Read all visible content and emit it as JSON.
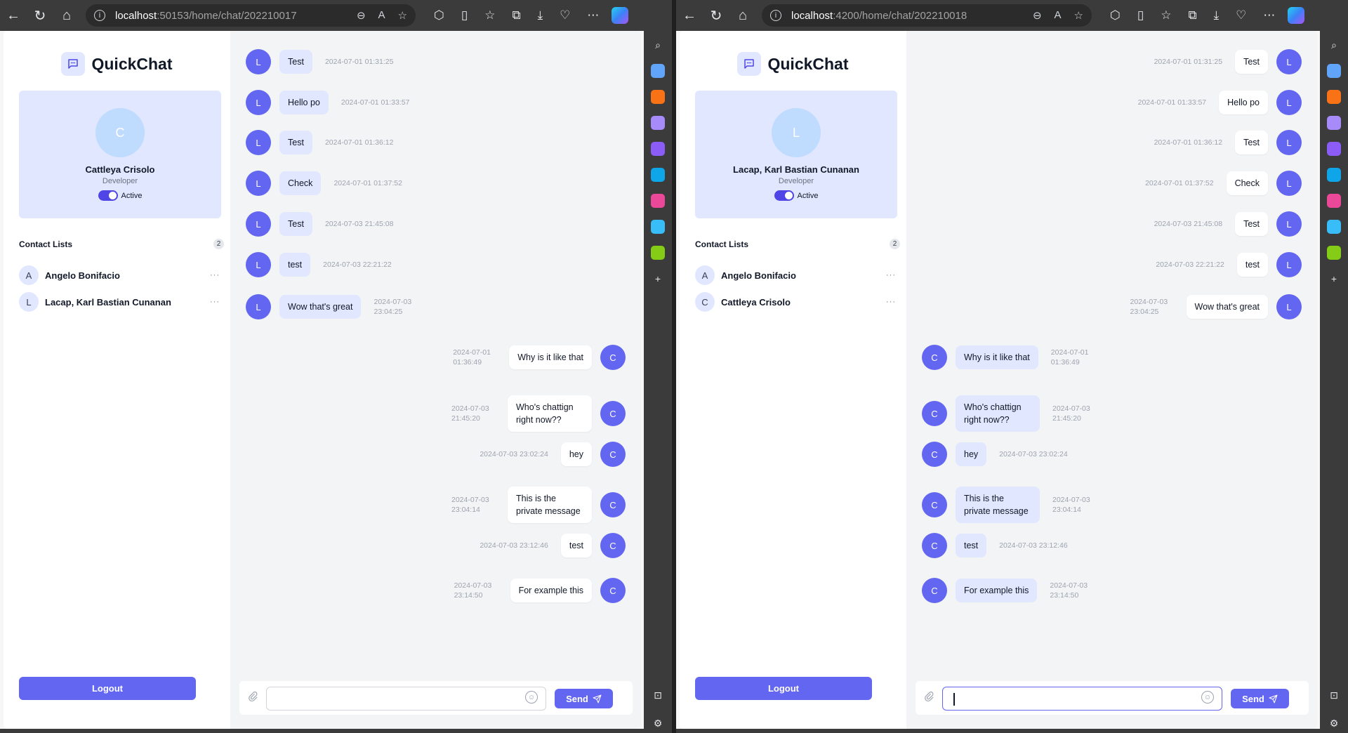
{
  "windows": [
    {
      "url_host": "localhost",
      "url_path": ":50153/home/chat/202210017",
      "brand": "QuickChat",
      "profile": {
        "initial": "C",
        "name": "Cattleya Crisolo",
        "role": "Developer",
        "status": "Active"
      },
      "contacts_title": "Contact Lists",
      "contacts_count": "2",
      "contacts": [
        {
          "initial": "A",
          "name": "Angelo Bonifacio"
        },
        {
          "initial": "L",
          "name": "Lacap, Karl Bastian Cunanan"
        }
      ],
      "logout": "Logout",
      "send": "Send",
      "messages": [
        {
          "side": "left",
          "initial": "L",
          "text": "Test",
          "time": "2024-07-01 01:31:25"
        },
        {
          "side": "left",
          "initial": "L",
          "text": "Hello po",
          "time": "2024-07-01 01:33:57"
        },
        {
          "side": "left",
          "initial": "L",
          "text": "Test",
          "time": "2024-07-01 01:36:12"
        },
        {
          "side": "left",
          "initial": "L",
          "text": "Check",
          "time": "2024-07-01 01:37:52"
        },
        {
          "side": "left",
          "initial": "L",
          "text": "Test",
          "time": "2024-07-03 21:45:08"
        },
        {
          "side": "left",
          "initial": "L",
          "text": "test",
          "time": "2024-07-03 22:21:22"
        },
        {
          "side": "left",
          "initial": "L",
          "text": "Wow that's great",
          "time": "2024-07-03 23:04:25"
        },
        {
          "side": "right",
          "initial": "C",
          "text": "Why is it like that",
          "time": "2024-07-01 01:36:49"
        },
        {
          "side": "right",
          "initial": "C",
          "text": "Who's chattign right now??",
          "time": "2024-07-03 21:45:20"
        },
        {
          "side": "right",
          "initial": "C",
          "text": "hey",
          "time": "2024-07-03 23:02:24"
        },
        {
          "side": "right",
          "initial": "C",
          "text": "This is the private message",
          "time": "2024-07-03 23:04:14"
        },
        {
          "side": "right",
          "initial": "C",
          "text": "test",
          "time": "2024-07-03 23:12:46"
        },
        {
          "side": "right",
          "initial": "C",
          "text": "For example this",
          "time": "2024-07-03 23:14:50"
        }
      ]
    },
    {
      "url_host": "localhost",
      "url_path": ":4200/home/chat/202210018",
      "brand": "QuickChat",
      "profile": {
        "initial": "L",
        "name": "Lacap, Karl Bastian Cunanan",
        "role": "Developer",
        "status": "Active"
      },
      "contacts_title": "Contact Lists",
      "contacts_count": "2",
      "contacts": [
        {
          "initial": "A",
          "name": "Angelo Bonifacio"
        },
        {
          "initial": "C",
          "name": "Cattleya Crisolo"
        }
      ],
      "logout": "Logout",
      "send": "Send",
      "messages": [
        {
          "side": "right",
          "initial": "L",
          "text": "Test",
          "time": "2024-07-01 01:31:25"
        },
        {
          "side": "right",
          "initial": "L",
          "text": "Hello po",
          "time": "2024-07-01 01:33:57"
        },
        {
          "side": "right",
          "initial": "L",
          "text": "Test",
          "time": "2024-07-01 01:36:12"
        },
        {
          "side": "right",
          "initial": "L",
          "text": "Check",
          "time": "2024-07-01 01:37:52"
        },
        {
          "side": "right",
          "initial": "L",
          "text": "Test",
          "time": "2024-07-03 21:45:08"
        },
        {
          "side": "right",
          "initial": "L",
          "text": "test",
          "time": "2024-07-03 22:21:22"
        },
        {
          "side": "right",
          "initial": "L",
          "text": "Wow that's great",
          "time": "2024-07-03 23:04:25"
        },
        {
          "side": "left",
          "initial": "C",
          "text": "Why is it like that",
          "time": "2024-07-01 01:36:49"
        },
        {
          "side": "left",
          "initial": "C",
          "text": "Who's chattign right now??",
          "time": "2024-07-03 21:45:20"
        },
        {
          "side": "left",
          "initial": "C",
          "text": "hey",
          "time": "2024-07-03 23:02:24"
        },
        {
          "side": "left",
          "initial": "C",
          "text": "This is the private message",
          "time": "2024-07-03 23:04:14"
        },
        {
          "side": "left",
          "initial": "C",
          "text": "test",
          "time": "2024-07-03 23:12:46"
        },
        {
          "side": "left",
          "initial": "C",
          "text": "For example this",
          "time": "2024-07-03 23:14:50"
        }
      ]
    }
  ],
  "theme": {
    "accent": "#6366f1",
    "bubble_received": "#e0e7ff",
    "bubble_sent": "#ffffff",
    "chat_bg": "#f3f4f6"
  }
}
